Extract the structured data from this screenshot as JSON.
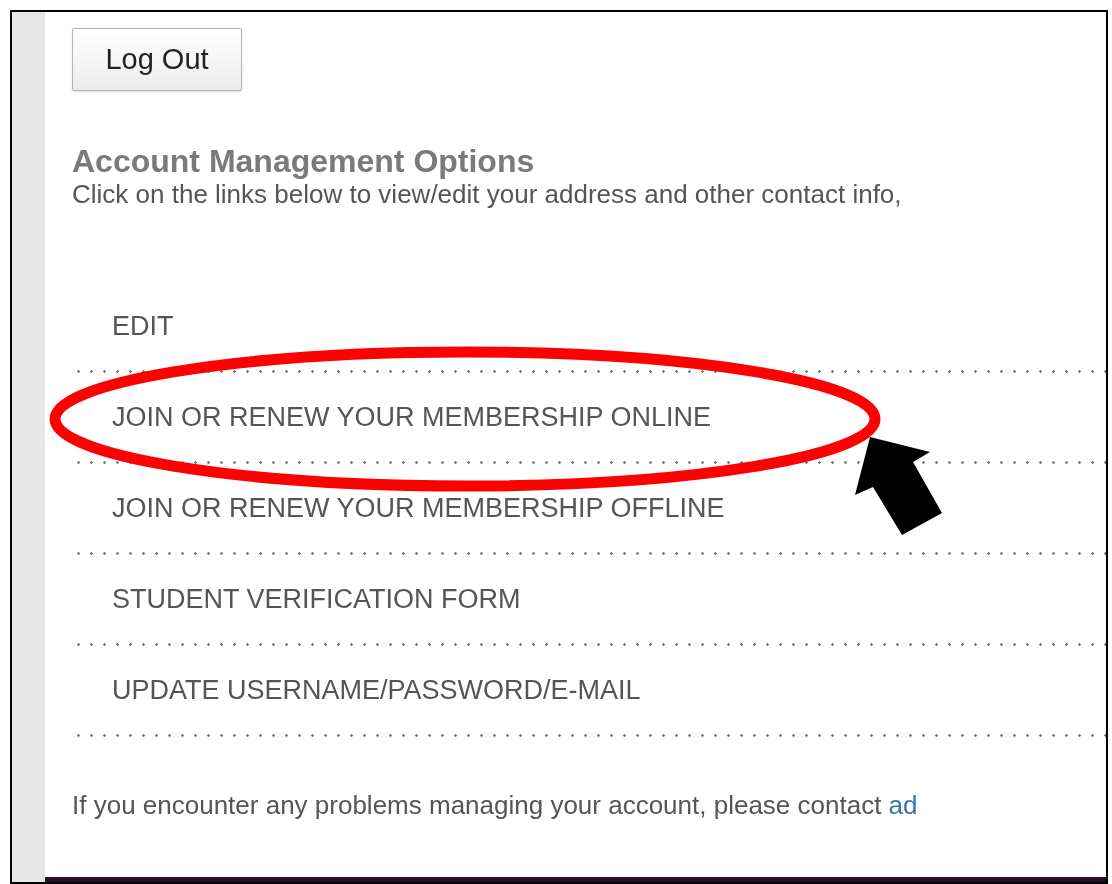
{
  "logout_button": "Log Out",
  "heading": "Account Management Options",
  "intro": "Click on the links below to view/edit your address and other contact info,",
  "links": [
    "EDIT",
    "JOIN OR RENEW YOUR MEMBERSHIP ONLINE",
    "JOIN OR RENEW YOUR MEMBERSHIP OFFLINE",
    "STUDENT VERIFICATION FORM",
    "UPDATE USERNAME/PASSWORD/E-MAIL"
  ],
  "footer": {
    "text": "If you encounter any problems managing your account, please contact ",
    "link": "ad"
  },
  "annotations": [
    {
      "kind": "ellipse"
    },
    {
      "kind": "arrow"
    }
  ]
}
